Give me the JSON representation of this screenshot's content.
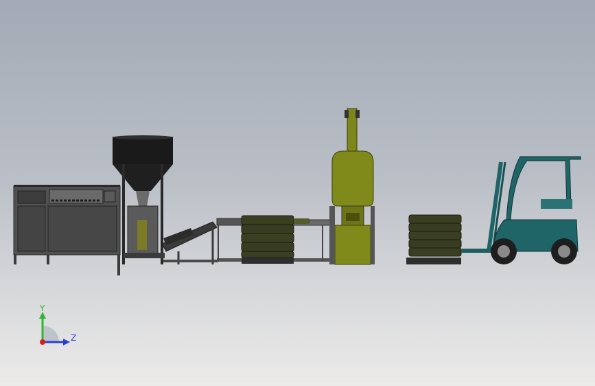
{
  "axes": {
    "y_label": "Y",
    "z_label": "Z",
    "y_color": "#2db82d",
    "z_color": "#2a3fd8",
    "x_color": "#d81e1e"
  },
  "colors": {
    "background_top": "#a3aab5",
    "background_bottom": "#ecebea",
    "machine_frame": "#555555",
    "hopper": "#1c1c1c",
    "palletizer_robot": "#808a1a",
    "bag_stack": "#3a3f20",
    "forklift": "#1f6466"
  },
  "scene": {
    "objects": [
      "bagging-machine",
      "hopper",
      "inclined-conveyor",
      "roller-conveyor",
      "bag-pallet-stack",
      "palletizing-robot",
      "finished-pallet",
      "forklift"
    ]
  }
}
